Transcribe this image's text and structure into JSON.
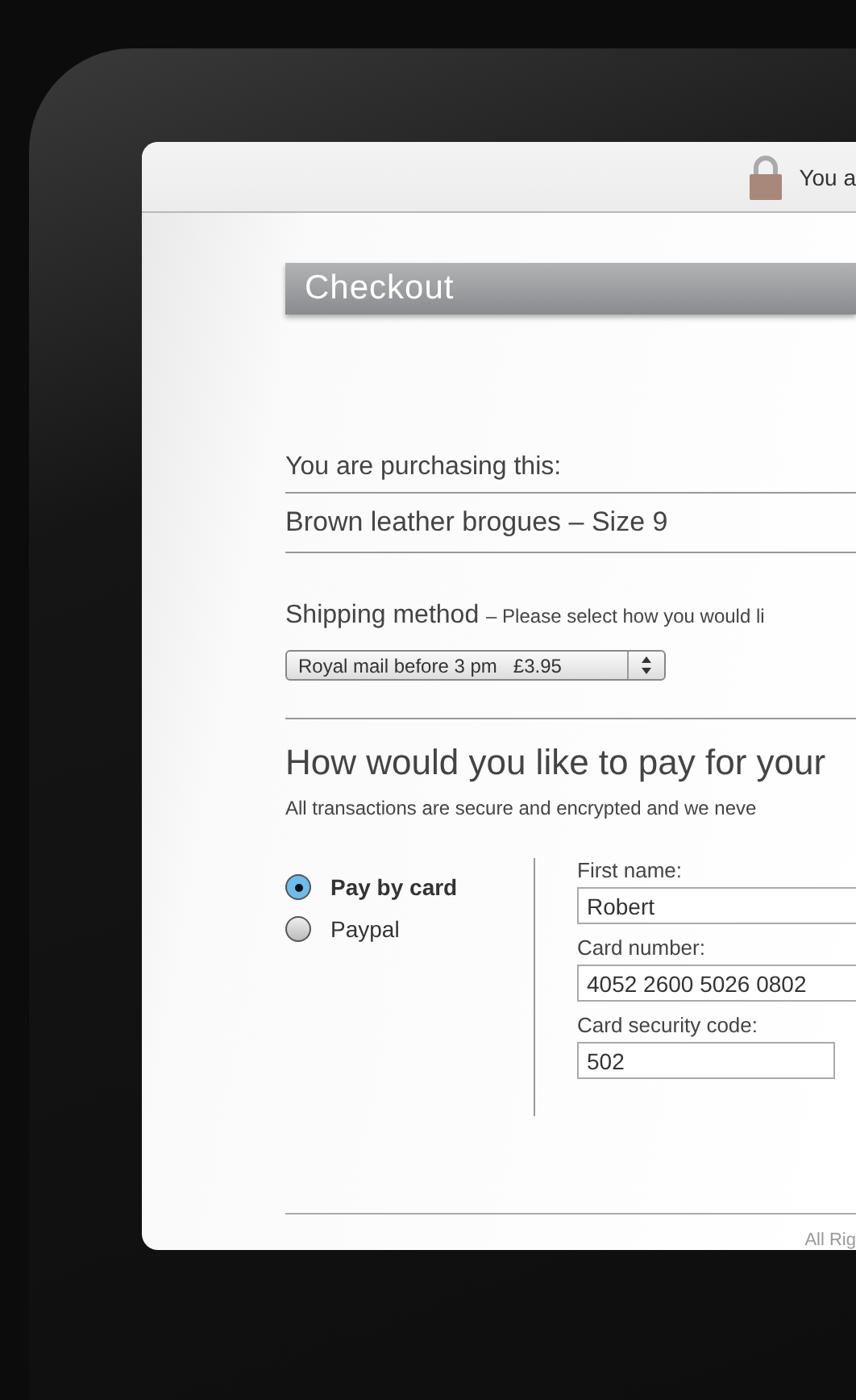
{
  "header": {
    "secure_note": "You a"
  },
  "title": "Checkout",
  "purchase": {
    "label": "You are purchasing this:",
    "item": "Brown leather brogues – Size 9"
  },
  "shipping": {
    "label": "Shipping method",
    "hint": "– Please select how you would li",
    "select_value": "Royal mail before 3 pm   £3.95"
  },
  "payment": {
    "heading": "How would you like to pay for your",
    "note": "All transactions are secure and encrypted and we neve",
    "options": [
      {
        "label": "Pay by card",
        "selected": true
      },
      {
        "label": "Paypal",
        "selected": false
      }
    ],
    "fields": [
      {
        "label": "First name:",
        "value": "Robert"
      },
      {
        "label": "Card number:",
        "value": "4052 2600 5026 0802"
      },
      {
        "label": "Card security code:",
        "value": "502"
      }
    ]
  },
  "footer": {
    "text": "All Rig"
  }
}
